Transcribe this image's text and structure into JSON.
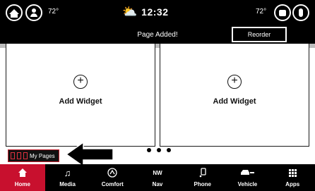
{
  "status_bar": {
    "left_temp": "72°",
    "right_temp": "72°",
    "time": "12:32",
    "icons": [
      "home-icon",
      "driver-profile-icon",
      "partly-sunny-icon",
      "record-icon",
      "microphone-icon"
    ]
  },
  "notification": {
    "message": "Page Added!",
    "reorder_label": "Reorder"
  },
  "widgets": [
    {
      "label": "Add Widget"
    },
    {
      "label": "Add Widget"
    }
  ],
  "page_indicator": {
    "count": 3
  },
  "my_pages": {
    "label": "My Pages"
  },
  "nav": {
    "items": [
      {
        "label": "Home",
        "icon": "home-icon",
        "active": true
      },
      {
        "label": "Media",
        "icon": "music-note-icon"
      },
      {
        "label": "Comfort",
        "icon": "seat-climate-icon"
      },
      {
        "label": "Nav",
        "icon": "compass-icon",
        "heading": "NW"
      },
      {
        "label": "Phone",
        "icon": "phone-icon"
      },
      {
        "label": "Vehicle",
        "icon": "car-icon"
      },
      {
        "label": "Apps",
        "icon": "app-grid-icon"
      }
    ]
  },
  "colors": {
    "accent": "#c8102e",
    "bar": "#000000",
    "background": "#ffffff"
  }
}
